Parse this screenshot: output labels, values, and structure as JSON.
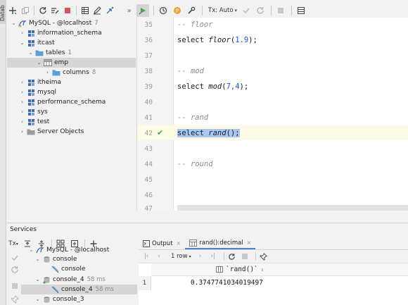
{
  "sidebar_strip": {
    "label": "Datab"
  },
  "left_toolbar": {
    "icons": [
      "add-icon",
      "copy-icon",
      "refresh-icon",
      "edit-schema-icon",
      "stop-icon",
      "table-view-icon",
      "edit-icon",
      "jump-icon",
      "more-icon"
    ]
  },
  "tree": {
    "items": [
      {
        "label": "MySQL - @localhost",
        "count": "7",
        "icon": "mysql-connection-icon",
        "expanded": true
      },
      {
        "label": "information_schema",
        "icon": "schema-icon",
        "expanded": false
      },
      {
        "label": "itcast",
        "icon": "schema-icon",
        "expanded": true
      },
      {
        "label": "tables",
        "count": "1",
        "icon": "folder-icon",
        "expanded": true
      },
      {
        "label": "emp",
        "icon": "table-icon",
        "expanded": true
      },
      {
        "label": "columns",
        "count": "8",
        "icon": "folder-icon",
        "expanded": false
      },
      {
        "label": "itheima",
        "icon": "schema-icon",
        "expanded": false
      },
      {
        "label": "mysql",
        "icon": "schema-icon",
        "expanded": false
      },
      {
        "label": "performance_schema",
        "icon": "schema-icon",
        "expanded": false
      },
      {
        "label": "sys",
        "icon": "schema-icon",
        "expanded": false
      },
      {
        "label": "test",
        "icon": "schema-icon",
        "expanded": false
      },
      {
        "label": "Server Objects",
        "icon": "server-objects-icon",
        "expanded": false
      }
    ]
  },
  "editor_toolbar": {
    "tx_mode": "Tx: Auto",
    "icons": [
      "run-icon",
      "history-icon",
      "profile-icon",
      "settings-icon",
      "commit-icon",
      "rollback-icon",
      "stop-icon",
      "grid-icon"
    ]
  },
  "editor": {
    "lines": [
      {
        "num": "35",
        "text": "-- floor",
        "kind": "comment"
      },
      {
        "num": "36",
        "kw": "select",
        "fn": "floor",
        "open": "(",
        "arg": "1.9",
        "close": ");",
        "kind": "code"
      },
      {
        "num": "37",
        "text": "",
        "kind": "blank"
      },
      {
        "num": "38",
        "text": "-- mod",
        "kind": "comment"
      },
      {
        "num": "39",
        "kw": "select",
        "fn": "mod",
        "open": "(",
        "arg": "7,4",
        "close": ");",
        "kind": "code"
      },
      {
        "num": "40",
        "text": "",
        "kind": "blank"
      },
      {
        "num": "41",
        "text": "-- rand",
        "kind": "comment"
      },
      {
        "num": "42",
        "kw": "select",
        "fn": "rand",
        "open": "(",
        "arg": "",
        "close": ");",
        "kind": "current"
      },
      {
        "num": "43",
        "text": "",
        "kind": "blank"
      },
      {
        "num": "44",
        "text": "-- round",
        "kind": "comment"
      },
      {
        "num": "45",
        "text": "",
        "kind": "blank"
      },
      {
        "num": "46",
        "text": "",
        "kind": "blank"
      },
      {
        "num": "47",
        "text": "",
        "kind": "blank"
      }
    ],
    "success_mark": "✔"
  },
  "services": {
    "title": "Services",
    "tx_label": "Tx",
    "tree": [
      {
        "label": "MySQL - @localhost",
        "icon": "mysql-connection-icon",
        "partial": true
      },
      {
        "label": "console",
        "icon": "console-icon",
        "expanded": true
      },
      {
        "label": "console",
        "icon": "console-file-icon",
        "leaf": true
      },
      {
        "label": "console_4",
        "time": "58 ms",
        "icon": "console-icon",
        "expanded": true
      },
      {
        "label": "console_4",
        "time": "58 ms",
        "icon": "console-file-icon",
        "leaf": true,
        "selected": true
      },
      {
        "label": "console_3",
        "icon": "console-icon",
        "expanded": true
      }
    ]
  },
  "results": {
    "tabs": [
      {
        "label": "Output",
        "icon": "output-icon",
        "active": false
      },
      {
        "label": "rand():decimal",
        "icon": "table-icon",
        "active": true
      }
    ],
    "toolbar": {
      "rows_label": "1 row"
    },
    "columns": [
      "`rand()`"
    ],
    "rows": [
      {
        "num": "1",
        "value": "0.3747741034019497"
      }
    ]
  },
  "colors": {
    "selection": "#a6c8f3",
    "current_line": "#fdfae6",
    "success": "#4aa347",
    "schema_blue": "#3d6eb5"
  }
}
